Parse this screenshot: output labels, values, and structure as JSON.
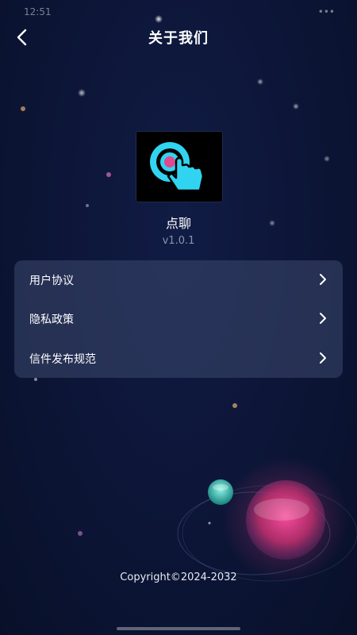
{
  "status_bar": {
    "time": "12:51",
    "right_text": "•••"
  },
  "header": {
    "back_icon": "back-arrow-icon",
    "title": "关于我们"
  },
  "app": {
    "logo_icon": "tap-target-icon",
    "name": "点聊",
    "version": "v1.0.1"
  },
  "menu": {
    "items": [
      {
        "label": "用户协议",
        "icon": "chevron-right-icon"
      },
      {
        "label": "隐私政策",
        "icon": "chevron-right-icon"
      },
      {
        "label": "信件发布规范",
        "icon": "chevron-right-icon"
      }
    ]
  },
  "footer": {
    "copyright": "Copyright©2024-2032"
  },
  "colors": {
    "background": "#0c1536",
    "card": "#3c486e",
    "logo_accent": "#31d4f0",
    "logo_center": "#e0488f"
  }
}
